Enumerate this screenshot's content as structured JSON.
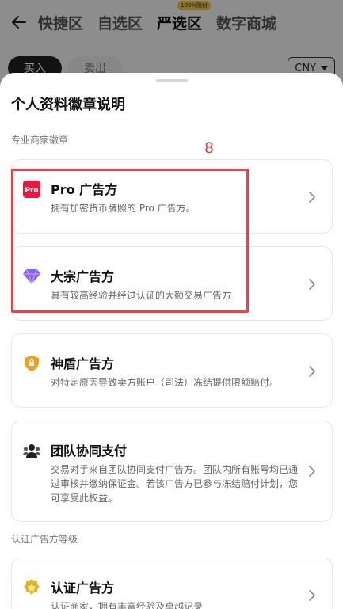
{
  "nav": {
    "tabs": [
      {
        "label": "快捷区"
      },
      {
        "label": "自选区"
      },
      {
        "label": "严选区",
        "badge": "100%赔付"
      },
      {
        "label": "数字商城"
      }
    ]
  },
  "trade": {
    "buy": "买入",
    "sell": "卖出",
    "currency": "CNY"
  },
  "sheet": {
    "title": "个人资料徽章说明",
    "section_pro": "专业商家徽章",
    "section_cert": "认证广告方等级",
    "annotation": "8",
    "cards": [
      {
        "title": "Pro 广告方",
        "desc": "拥有加密货币牌照的 Pro 广告方。",
        "icon": "pro-badge-icon"
      },
      {
        "title": "大宗广告方",
        "desc": "具有较高经验并经过认证的大额交易广告方",
        "icon": "diamond-icon"
      },
      {
        "title": "神盾广告方",
        "desc": "对特定原因导致卖方账户（司法）冻结提供限额赔付。",
        "icon": "shield-icon"
      },
      {
        "title": "团队协同支付",
        "desc": "交易对手来自团队协同支付广告方。团队内所有账号均已通过审核并缴纳保证金。若该广告方已参与冻结赔付计划，您可享受此权益。",
        "icon": "team-icon"
      },
      {
        "title": "认证广告方",
        "desc": "认证商家，拥有丰富经验及卓越记录",
        "icon": "verified-icon"
      }
    ]
  },
  "colors": {
    "accent_red": "#e8434c",
    "pro_red": "#e8173f",
    "diamond_purple": "#8b5cf6",
    "shield_orange": "#f0a020",
    "gold": "#e6b422"
  }
}
